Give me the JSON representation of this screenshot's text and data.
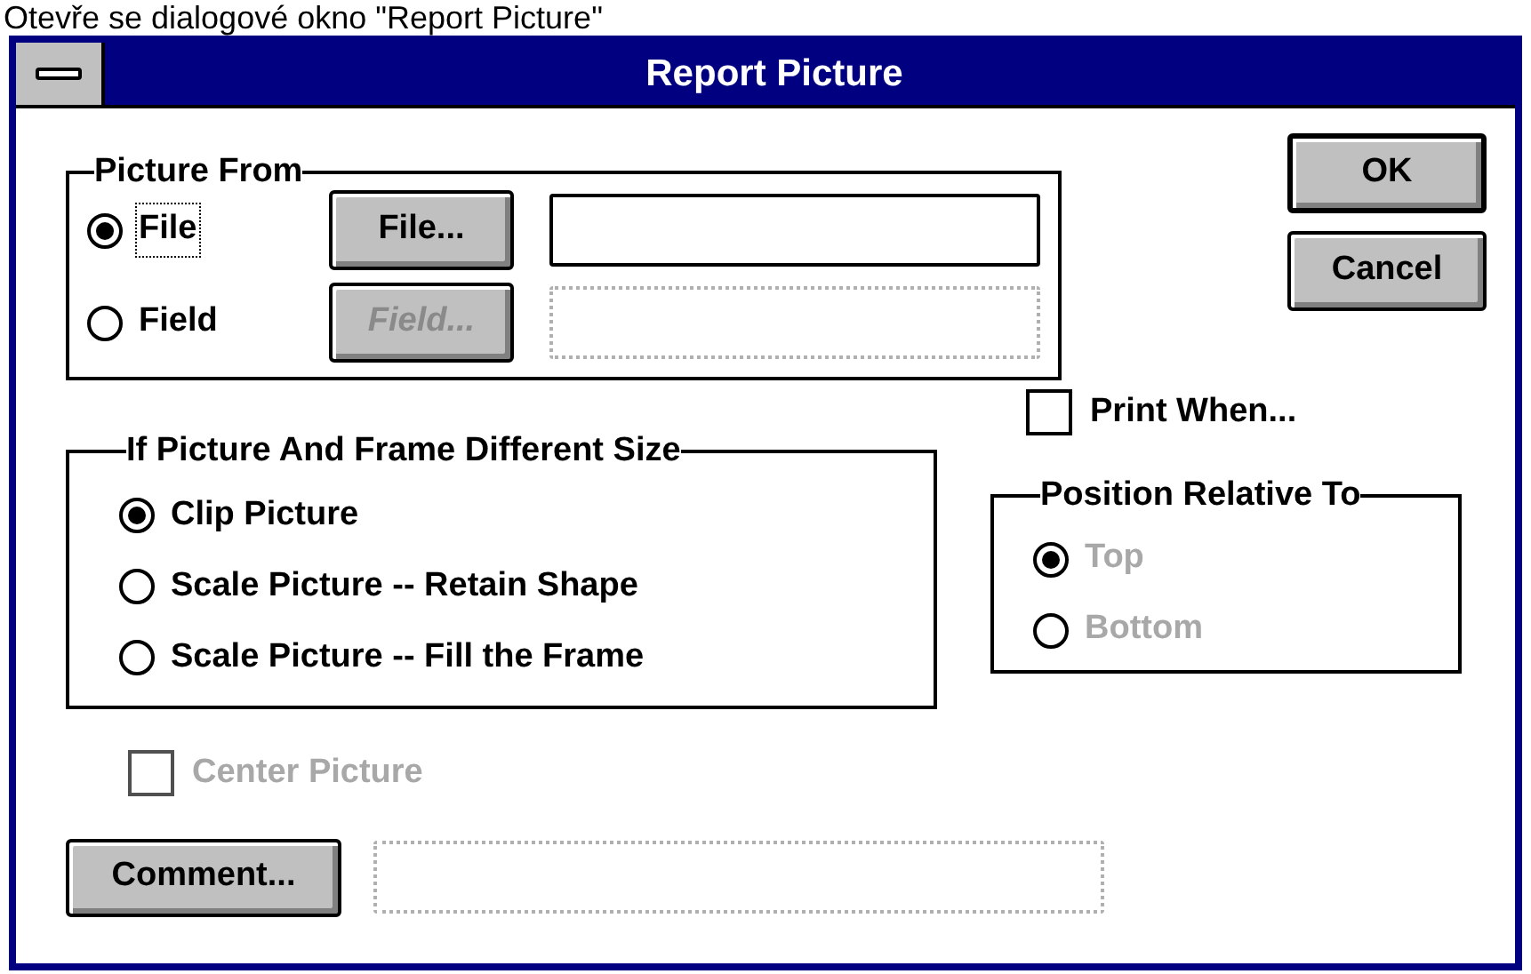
{
  "caption": "Otevře se dialogové okno \"Report Picture\"",
  "window": {
    "title": "Report Picture"
  },
  "picture_from": {
    "title": "Picture From",
    "options": [
      {
        "label": "File",
        "selected": true,
        "focused": true,
        "button": {
          "label": "File...",
          "disabled": false
        },
        "field": {
          "disabled": false
        }
      },
      {
        "label": "Field",
        "selected": false,
        "focused": false,
        "button": {
          "label": "Field...",
          "disabled": true
        },
        "field": {
          "disabled": true
        }
      }
    ]
  },
  "buttons": [
    {
      "label": "OK",
      "default": true
    },
    {
      "label": "Cancel",
      "default": false
    }
  ],
  "size_group": {
    "title": "If Picture And Frame Different Size",
    "options": [
      {
        "label": "Clip Picture",
        "selected": true
      },
      {
        "label": "Scale Picture -- Retain Shape",
        "selected": false
      },
      {
        "label": "Scale Picture -- Fill the Frame",
        "selected": false
      }
    ]
  },
  "print_when": {
    "label": "Print When...",
    "checked": false
  },
  "position_group": {
    "title": "Position Relative To",
    "disabled": true,
    "options": [
      {
        "label": "Top",
        "selected": true
      },
      {
        "label": "Bottom",
        "selected": false
      }
    ]
  },
  "center_picture": {
    "label": "Center Picture",
    "checked": false,
    "disabled": true
  },
  "comment": {
    "button": {
      "label": "Comment...",
      "disabled": false
    },
    "field": {
      "disabled": true
    }
  }
}
